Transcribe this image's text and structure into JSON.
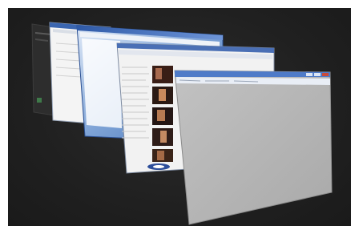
{
  "scene": {
    "name": "flip-3d-window-switcher",
    "background_color": "#222222"
  },
  "windows": [
    {
      "id": "window-1",
      "kind": "dark-sidebar-app",
      "titlebar_color": "#2d2d2d"
    },
    {
      "id": "window-2",
      "kind": "document-window",
      "titlebar_color": "#3b66b0"
    },
    {
      "id": "window-3",
      "kind": "explorer-window",
      "titlebar_color": "#3a67b8"
    },
    {
      "id": "window-4",
      "kind": "photo-gallery-browser",
      "titlebar_color": "#4a6fb5"
    },
    {
      "id": "window-5",
      "kind": "blank-gray-window",
      "titlebar_color": "#4f7bc8",
      "body_color": "#b5b5b5"
    }
  ]
}
